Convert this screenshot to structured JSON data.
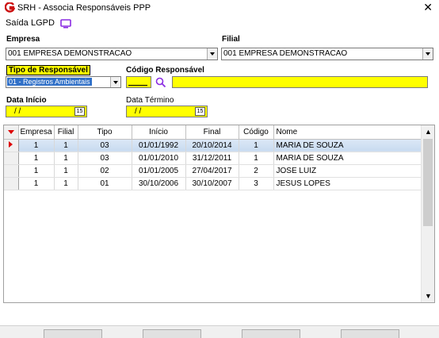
{
  "window": {
    "title": "SRH - Associa Responsáveis PPP",
    "close_glyph": "✕"
  },
  "menu": {
    "saida": "Saída",
    "lgpd": "LGPD"
  },
  "form": {
    "empresa_label": "Empresa",
    "empresa_value": "001 EMPRESA DEMONSTRACAO",
    "filial_label": "Filial",
    "filial_value": "001 EMPRESA DEMONSTRACAO",
    "tipo_label": "Tipo de Responsável",
    "tipo_value": "01 - Registros Ambientais",
    "codigo_label": "Código Responsável",
    "codigo_value": "",
    "nome_value": "",
    "data_inicio_label": "Data Início",
    "data_inicio_value": "/ /",
    "data_termino_label": "Data Término",
    "data_termino_value": "/ /",
    "calendar_glyph": "15"
  },
  "grid": {
    "columns": [
      "Empresa",
      "Filial",
      "Tipo",
      "Início",
      "Final",
      "Código",
      "Nome"
    ],
    "rows": [
      {
        "empresa": "1",
        "filial": "1",
        "tipo": "03",
        "inicio": "01/01/1992",
        "final": "20/10/2014",
        "codigo": "1",
        "nome": "MARIA DE SOUZA",
        "selected": true
      },
      {
        "empresa": "1",
        "filial": "1",
        "tipo": "03",
        "inicio": "01/01/2010",
        "final": "31/12/2011",
        "codigo": "1",
        "nome": "MARIA DE SOUZA",
        "selected": false
      },
      {
        "empresa": "1",
        "filial": "1",
        "tipo": "02",
        "inicio": "01/01/2005",
        "final": "27/04/2017",
        "codigo": "2",
        "nome": "JOSE LUIZ",
        "selected": false
      },
      {
        "empresa": "1",
        "filial": "1",
        "tipo": "01",
        "inicio": "30/10/2006",
        "final": "30/10/2007",
        "codigo": "3",
        "nome": "JESUS LOPES",
        "selected": false
      }
    ],
    "scroll_up": "▲",
    "scroll_down": "▼"
  },
  "colors": {
    "required_field": "#ffff00",
    "selected_row": "#c7daf0",
    "indicator": "#dd0000",
    "brand": "#cc1111",
    "lgpd_icon": "#8a2be2"
  }
}
